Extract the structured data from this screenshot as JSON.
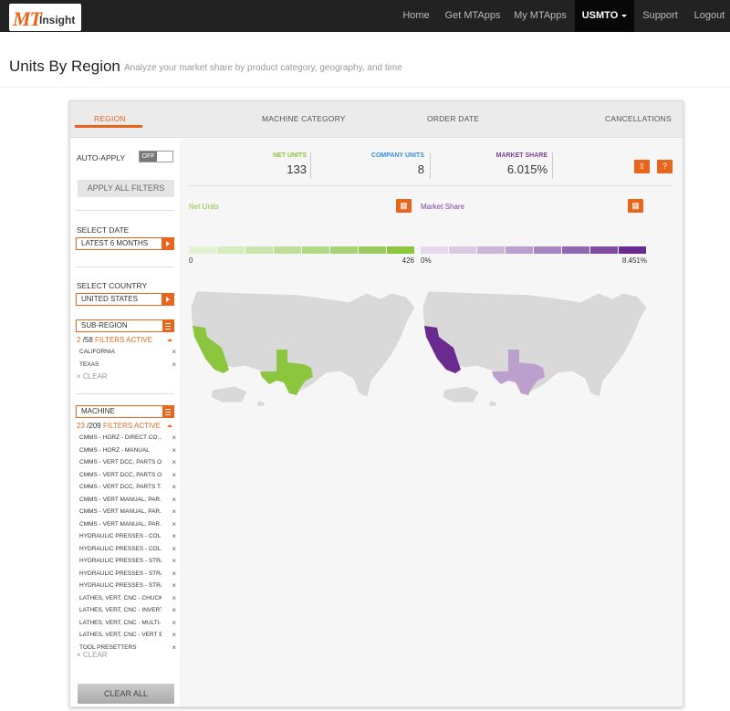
{
  "app": {
    "logo_mt": "MT",
    "logo_insight": "Insight"
  },
  "nav": {
    "home": "Home",
    "get_mtapps": "Get MTApps",
    "my_mtapps": "My MTApps",
    "account": "USMTO",
    "support": "Support",
    "logout": "Logout"
  },
  "page": {
    "title": "Units By Region",
    "subtitle": "Analyze your market share by product category, geography, and time"
  },
  "tabs": {
    "region": "REGION",
    "machine_category": "MACHINE CATEGORY",
    "order_date": "ORDER DATE",
    "cancellations": "CANCELLATIONS"
  },
  "sidebar": {
    "auto_apply_label": "AUTO-APPLY",
    "toggle_state": "OFF",
    "apply_all": "APPLY ALL FILTERS",
    "select_date_label": "SELECT DATE",
    "select_date_value": "LATEST 6 MONTHS",
    "select_country_label": "SELECT COUNTRY",
    "select_country_value": "UNITED STATES",
    "subregion": {
      "label": "SUB-REGION",
      "active_count": "2",
      "total": "/58",
      "filters_active": "FILTERS ACTIVE",
      "items": [
        "CALIFORNIA",
        "TEXAS"
      ],
      "clear": "CLEAR"
    },
    "machine": {
      "label": "MACHINE",
      "active_count": "23",
      "total": "/209",
      "filters_active": "FILTERS ACTIVE",
      "items": [
        "CMMS - HORZ - DIRECT CO...",
        "CMMS - HORZ - MANUAL",
        "CMMS - VERT DCC, PARTS O...",
        "CMMS - VERT DCC, PARTS O...",
        "CMMS - VERT DCC, PARTS T...",
        "CMMS - VERT MANUAL, PAR...",
        "CMMS - VERT MANUAL, PAR...",
        "CMMS - VERT MANUAL, PAR...",
        "HYDRAULIC PRESSES - COL...",
        "HYDRAULIC PRESSES - COL...",
        "HYDRAULIC PRESSES - STRA...",
        "HYDRAULIC PRESSES - STRA...",
        "HYDRAULIC PRESSES - STRA...",
        "LATHES, VERT, CNC - CHUCK...",
        "LATHES, VERT, CNC - INVERT...",
        "LATHES, VERT, CNC - MULTI-...",
        "LATHES, VERT, CNC - VERT B...",
        "TOOL PRESETTERS"
      ],
      "clear": "CLEAR"
    },
    "clear_all": "CLEAR ALL",
    "remove_glyph": "×"
  },
  "kpis": {
    "net_units": {
      "label": "NET UNITS",
      "value": "133",
      "color": "#8cc63f"
    },
    "company_units": {
      "label": "COMPANY UNITS",
      "value": "8",
      "color": "#3a8fd9"
    },
    "market_share": {
      "label": "MARKET SHARE",
      "value": "6.015%",
      "color": "#7b3f9e"
    }
  },
  "buttons": {
    "export_icon": "⇪",
    "help": "?",
    "grid_icon": "▦"
  },
  "maps": {
    "net_units": {
      "label": "Net Units",
      "min": "0",
      "max": "426",
      "color": "#8cc63f"
    },
    "market_share": {
      "label": "Market Share",
      "min": "0%",
      "max": "8.451%",
      "color": "#6a2a90"
    }
  },
  "colors": {
    "accent": "#e8661b",
    "green_scale": [
      "#e4f2d4",
      "#d8ecc1",
      "#cbe6ad",
      "#bfdf9a",
      "#b2d986",
      "#a6d373",
      "#99cc5f",
      "#8cc63f"
    ],
    "purple_scale": [
      "#e6d9ec",
      "#dacbe3",
      "#ccb6d9",
      "#bba0cd",
      "#a886bf",
      "#9468b0",
      "#7f4ca1",
      "#6a2a90"
    ],
    "map_base": "#d9d9d9",
    "ca_green": "#8cc63f",
    "tx_green": "#8cc63f",
    "ca_purple": "#6a2a90",
    "tx_purple": "#bba0cd"
  }
}
